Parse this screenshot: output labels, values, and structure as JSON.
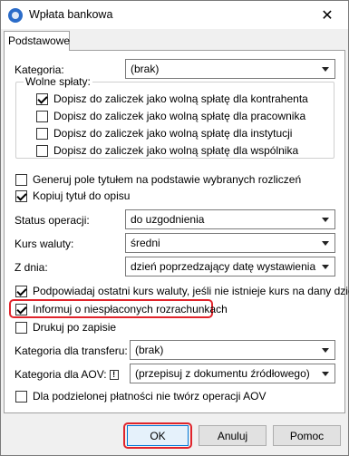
{
  "window": {
    "title": "Wpłata bankowa"
  },
  "tabs": [
    {
      "label": "Podstawowe"
    }
  ],
  "kategoria": {
    "label": "Kategoria:",
    "value": "(brak)"
  },
  "wolne_splaty": {
    "legend": "Wolne spłaty:",
    "items": [
      {
        "label": "Dopisz do zaliczek jako wolną spłatę dla kontrahenta",
        "checked": true
      },
      {
        "label": "Dopisz do zaliczek jako wolną spłatę dla pracownika",
        "checked": false
      },
      {
        "label": "Dopisz do zaliczek jako wolną spłatę dla instytucji",
        "checked": false
      },
      {
        "label": "Dopisz do zaliczek jako wolną spłatę dla wspólnika",
        "checked": false
      }
    ]
  },
  "options1": [
    {
      "label": "Generuj pole tytułem na podstawie wybranych rozliczeń",
      "checked": false
    },
    {
      "label": "Kopiuj tytuł do opisu",
      "checked": true
    }
  ],
  "status": {
    "label": "Status operacji:",
    "value": "do uzgodnienia"
  },
  "kurs": {
    "label": "Kurs waluty:",
    "value": "średni"
  },
  "zdnia": {
    "label": "Z dnia:",
    "value": "dzień poprzedzający datę wystawienia"
  },
  "options2": [
    {
      "label": "Podpowiadaj ostatni kurs waluty, jeśli nie istnieje kurs na dany dzień",
      "checked": true
    },
    {
      "label": "Informuj o niespłaconych rozrachunkach",
      "checked": true
    },
    {
      "label": "Drukuj po zapisie",
      "checked": false
    }
  ],
  "kategoria_transfer": {
    "label": "Kategoria dla transferu:",
    "value": "(brak)"
  },
  "kategoria_aov": {
    "label": "Kategoria dla AOV:",
    "value": "(przepisuj z dokumentu źródłowego)"
  },
  "aov_option": {
    "label": "Dla podzielonej płatności nie twórz operacji AOV",
    "checked": false
  },
  "buttons": {
    "ok": "OK",
    "cancel": "Anuluj",
    "help": "Pomoc"
  },
  "colors": {
    "highlight": "#e0242b",
    "window_bg": "#f0f0f0"
  },
  "icons": {
    "app": "app-logo-icon",
    "close": "close-icon",
    "info": "info-icon"
  }
}
